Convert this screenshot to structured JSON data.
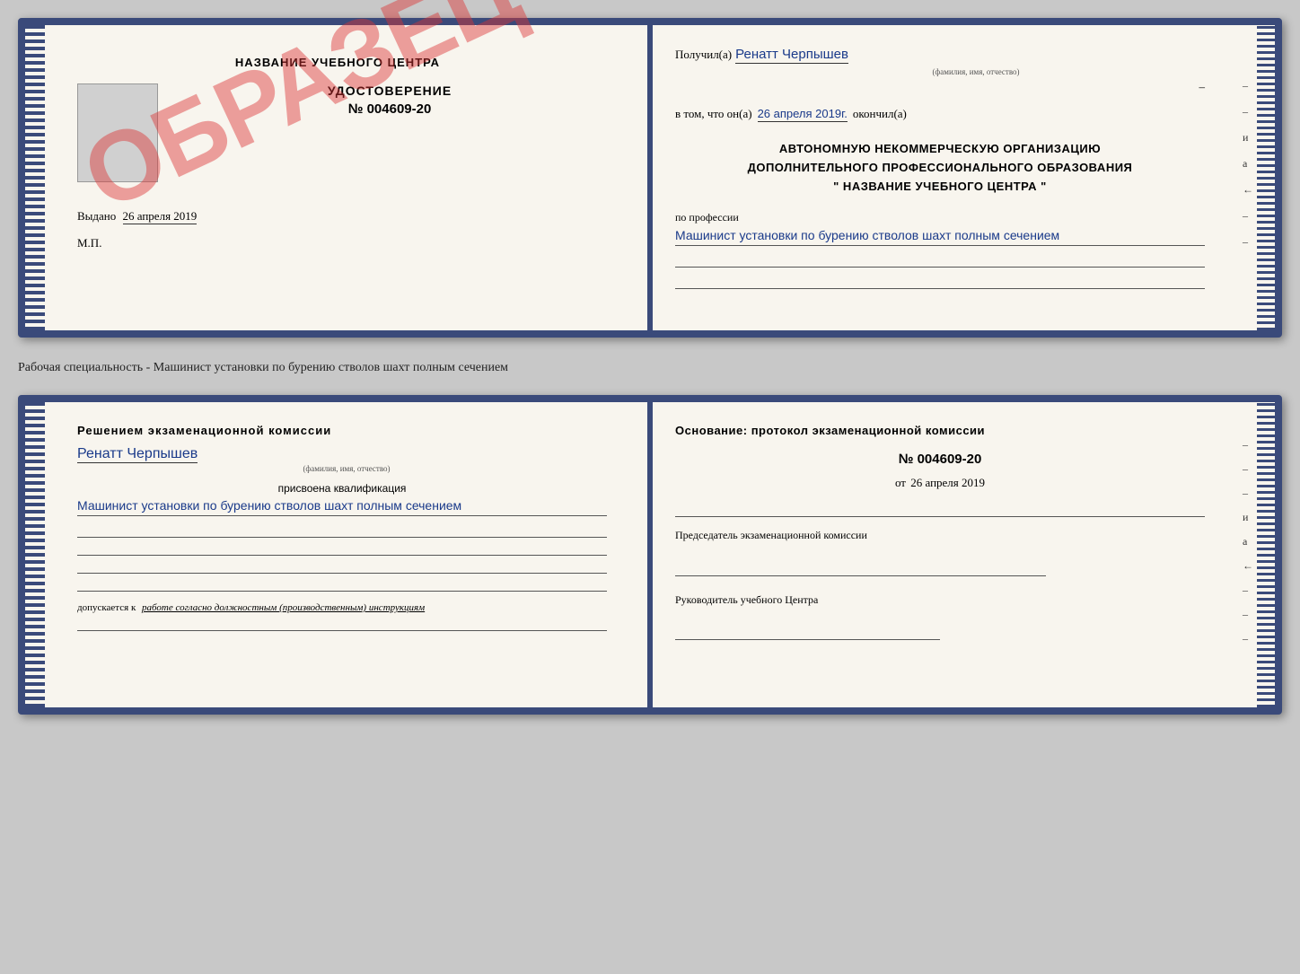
{
  "page": {
    "background_color": "#c8c8c8"
  },
  "top_document": {
    "left_page": {
      "title": "НАЗВАНИЕ УЧЕБНОГО ЦЕНТРА",
      "cert_label": "УДОСТОВЕРЕНИЕ",
      "cert_number": "№ 004609-20",
      "stamp_text": "ОБРАЗЕЦ",
      "issued_label": "Выдано",
      "issued_date": "26 апреля 2019",
      "mp_label": "М.П."
    },
    "right_page": {
      "received_prefix": "Получил(а)",
      "recipient_name": "Ренатт Черпышев",
      "recipient_sublabel": "(фамилия, имя, отчество)",
      "in_that_prefix": "в том, что он(а)",
      "completion_date": "26 апреля 2019г.",
      "completed_suffix": "окончил(а)",
      "org_line1": "АВТОНОМНУЮ НЕКОММЕРЧЕСКУЮ ОРГАНИЗАЦИЮ",
      "org_line2": "ДОПОЛНИТЕЛЬНОГО ПРОФЕССИОНАЛЬНОГО ОБРАЗОВАНИЯ",
      "org_line3": "\"   НАЗВАНИЕ УЧЕБНОГО ЦЕНТРА   \"",
      "profession_prefix": "по профессии",
      "profession_name": "Машинист установки по бурению стволов шахт полным сечением",
      "dash_items": [
        "-",
        "-",
        "и",
        "а",
        "←",
        "-",
        "-"
      ]
    }
  },
  "separator": {
    "text": "Рабочая специальность - Машинист установки по бурению стволов шахт полным сечением"
  },
  "bottom_document": {
    "left_page": {
      "decision_title": "Решением экзаменационной комиссии",
      "person_name": "Ренатт Черпышев",
      "person_sublabel": "(фамилия, имя, отчество)",
      "qualification_prefix": "присвоена квалификация",
      "qualification_name": "Машинист установки по бурению стволов шахт полным сечением",
      "underlines": [
        "",
        "",
        "",
        ""
      ],
      "allowed_prefix": "допускается к",
      "allowed_text": "работе согласно должностным (производственным) инструкциям",
      "bottom_underline": ""
    },
    "right_page": {
      "basis_title": "Основание: протокол экзаменационной комиссии",
      "protocol_number": "№ 004609-20",
      "date_prefix": "от",
      "protocol_date": "26 апреля 2019",
      "chairman_label": "Председатель экзаменационной комиссии",
      "director_label": "Руководитель учебного Центра",
      "dash_items": [
        "-",
        "-",
        "-",
        "и",
        "а",
        "←",
        "-",
        "-",
        "-"
      ]
    }
  }
}
